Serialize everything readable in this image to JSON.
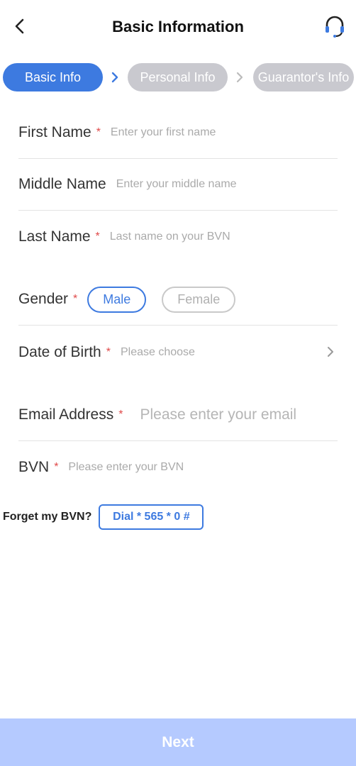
{
  "header": {
    "title": "Basic Information",
    "back_icon": "chevron-left-icon",
    "support_icon": "headset-icon"
  },
  "steps": [
    {
      "label": "Basic Info",
      "state": "active"
    },
    {
      "label": "Personal Info",
      "state": "inactive"
    },
    {
      "label": "Guarantor's Info",
      "state": "inactive"
    }
  ],
  "form": {
    "first_name": {
      "label": "First Name",
      "required": "*",
      "placeholder": "Enter your first name"
    },
    "middle_name": {
      "label": "Middle Name",
      "placeholder": "Enter your middle name"
    },
    "last_name": {
      "label": "Last Name",
      "required": "*",
      "placeholder": "Last name on your BVN"
    },
    "gender": {
      "label": "Gender",
      "required": "*",
      "options": [
        "Male",
        "Female"
      ],
      "selected": "Male"
    },
    "dob": {
      "label": "Date of Birth",
      "required": "*",
      "placeholder": "Please choose"
    },
    "email": {
      "label": "Email Address",
      "required": "*",
      "placeholder": "Please enter your email"
    },
    "bvn": {
      "label": "BVN",
      "required": "*",
      "placeholder": "Please enter your BVN"
    }
  },
  "forget_bvn": {
    "label": "Forget my BVN?",
    "dial": "Dial * 565 * 0 #"
  },
  "footer": {
    "next_label": "Next"
  },
  "colors": {
    "accent": "#3d7ae0",
    "step_inactive": "#c9c9cf",
    "next_disabled": "#b5caff",
    "required": "#e04a4a"
  }
}
